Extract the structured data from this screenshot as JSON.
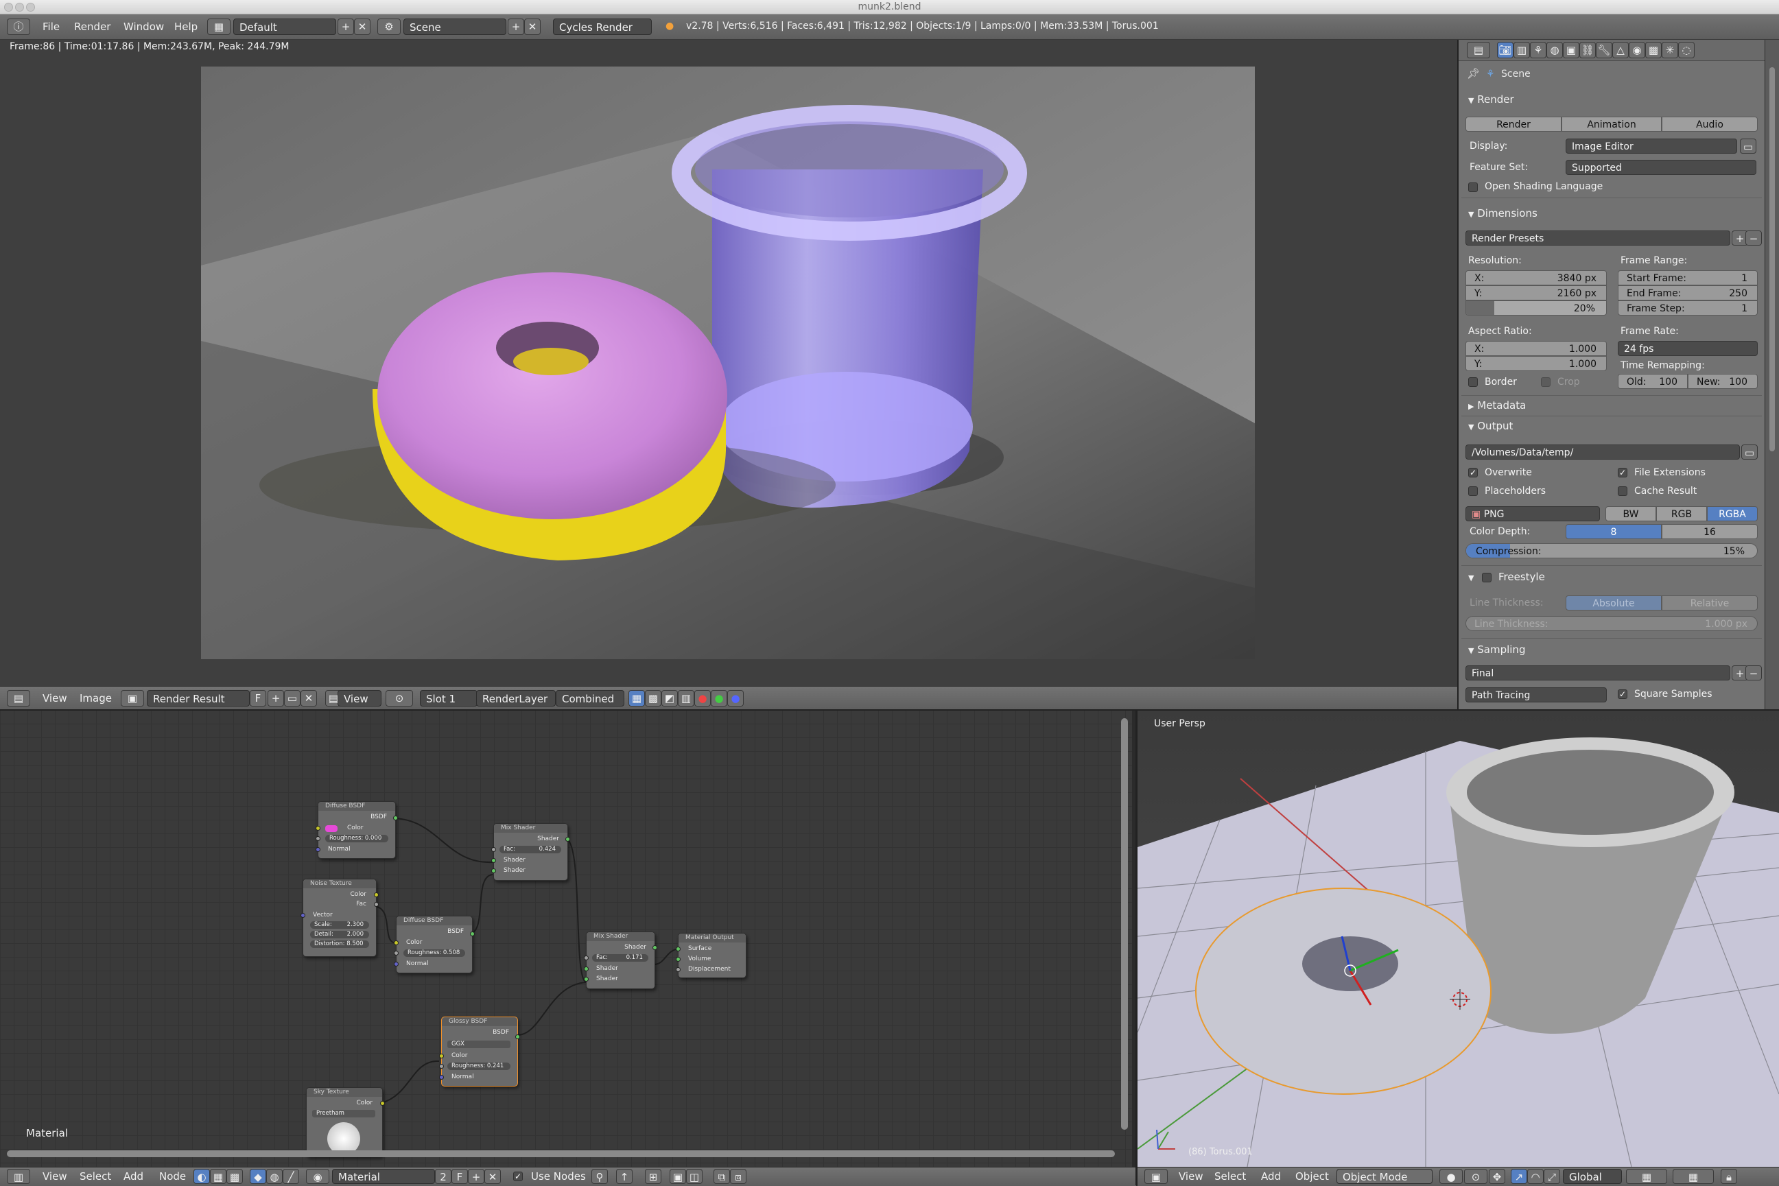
{
  "window": {
    "title": "munk2.blend"
  },
  "topbar": {
    "menus": [
      "File",
      "Render",
      "Window",
      "Help"
    ],
    "layout": "Default",
    "scene": "Scene",
    "engine": "Cycles Render",
    "stats": "v2.78 | Verts:6,516 | Faces:6,491 | Tris:12,982 | Objects:1/9 | Lamps:0/0 | Mem:33.53M | Torus.001"
  },
  "image_editor": {
    "frame_info": "Frame:86 | Time:01:17.86 | Mem:243.67M, Peak: 244.79M",
    "header": {
      "menus": [
        "View",
        "Image"
      ],
      "image": "Render Result",
      "fake_user": "F",
      "view": "View",
      "slot": "Slot 1",
      "layer": "RenderLayer",
      "pass": "Combined"
    }
  },
  "node_editor": {
    "label": "Material",
    "header": {
      "menus": [
        "View",
        "Select",
        "Add",
        "Node"
      ],
      "material": "Material",
      "users": "2",
      "fake_user": "F",
      "use_nodes": "Use Nodes"
    },
    "nodes": {
      "diffuse1": {
        "title": "Diffuse BSDF",
        "out": "BSDF",
        "color": "Color",
        "rough": "Roughness: 0.000",
        "normal": "Normal"
      },
      "noise": {
        "title": "Noise Texture",
        "color": "Color",
        "fac": "Fac",
        "vector": "Vector",
        "scale": "Scale:",
        "scale_v": "2.300",
        "detail": "Detail:",
        "detail_v": "2.000",
        "dist": "Distortion: 8.500"
      },
      "diffuse2": {
        "title": "Diffuse BSDF",
        "out": "BSDF",
        "color": "Color",
        "rough": "Roughness: 0.508",
        "normal": "Normal"
      },
      "mix1": {
        "title": "Mix Shader",
        "out": "Shader",
        "fac": "Fac:",
        "fac_v": "0.424",
        "s1": "Shader",
        "s2": "Shader"
      },
      "mix2": {
        "title": "Mix Shader",
        "out": "Shader",
        "fac": "Fac:",
        "fac_v": "0.171",
        "s1": "Shader",
        "s2": "Shader"
      },
      "output": {
        "title": "Material Output",
        "surface": "Surface",
        "volume": "Volume",
        "disp": "Displacement"
      },
      "glossy": {
        "title": "Glossy BSDF",
        "out": "BSDF",
        "dist": "GGX",
        "color": "Color",
        "rough": "Roughness: 0.241",
        "normal": "Normal"
      },
      "sky": {
        "title": "Sky Texture",
        "color": "Color",
        "type": "Preetham"
      }
    }
  },
  "viewport": {
    "label": "User Persp",
    "object": "(86) Torus.001",
    "header": {
      "menus": [
        "View",
        "Select",
        "Add",
        "Object"
      ],
      "mode": "Object Mode",
      "orientation": "Global"
    }
  },
  "properties": {
    "scene": "Scene",
    "render": {
      "title": "Render",
      "buttons": [
        "Render",
        "Animation",
        "Audio"
      ],
      "display_label": "Display:",
      "display": "Image Editor",
      "feature_label": "Feature Set:",
      "feature": "Supported",
      "osl": "Open Shading Language"
    },
    "dimensions": {
      "title": "Dimensions",
      "presets": "Render Presets",
      "resolution": "Resolution:",
      "res_x_label": "X:",
      "res_x": "3840 px",
      "res_y_label": "Y:",
      "res_y": "2160 px",
      "res_pct": "20%",
      "res_pct_value": 0.2,
      "aspect": "Aspect Ratio:",
      "asp_x_label": "X:",
      "asp_x": "1.000",
      "asp_y_label": "Y:",
      "asp_y": "1.000",
      "border": "Border",
      "crop": "Crop",
      "frame_range": "Frame Range:",
      "start_label": "Start Frame:",
      "start": "1",
      "end_label": "End Frame:",
      "end": "250",
      "step_label": "Frame Step:",
      "step": "1",
      "frame_rate": "Frame Rate:",
      "fps": "24 fps",
      "remap": "Time Remapping:",
      "old_label": "Old:",
      "old": "100",
      "new_label": "New:",
      "new": "100"
    },
    "metadata": {
      "title": "Metadata"
    },
    "output": {
      "title": "Output",
      "path": "/Volumes/Data/temp/",
      "overwrite": "Overwrite",
      "file_ext": "File Extensions",
      "placeholders": "Placeholders",
      "cache": "Cache Result",
      "format": "PNG",
      "modes": [
        "BW",
        "RGB",
        "RGBA"
      ],
      "depth_label": "Color Depth:",
      "depths": [
        "8",
        "16"
      ],
      "compression_label": "Compression:",
      "compression": "15%",
      "compression_value": 0.15
    },
    "freestyle": {
      "title": "Freestyle",
      "thickness_label": "Line Thickness:",
      "modes": [
        "Absolute",
        "Relative"
      ],
      "thickness_field": "Line Thickness:",
      "thickness": "1.000 px"
    },
    "sampling": {
      "title": "Sampling",
      "preset": "Final",
      "integrator": "Path Tracing",
      "square": "Square Samples"
    }
  },
  "colors": {
    "accent": "#5680c2",
    "donut_icing": "#c987d8",
    "donut_base": "#e8d21a",
    "glass": "#9c8cff"
  }
}
